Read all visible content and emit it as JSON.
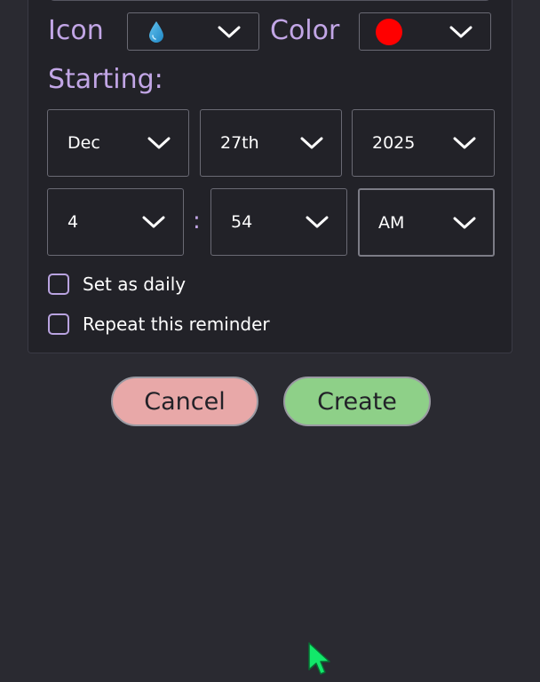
{
  "form": {
    "icon_label": "Icon",
    "color_label": "Color",
    "starting_label": "Starting:",
    "icon_select": {
      "icon": "water-drop-icon"
    },
    "color_select": {
      "color": "#ff0000"
    },
    "date": {
      "month": "Dec",
      "day": "27th",
      "year": "2025"
    },
    "time": {
      "hour": "4",
      "separator": ":",
      "minute": "54",
      "period": "AM"
    },
    "options": {
      "daily_label": "Set as daily",
      "repeat_label": "Repeat this reminder"
    }
  },
  "actions": {
    "cancel_label": "Cancel",
    "create_label": "Create"
  },
  "colors": {
    "background": "#2a2a31",
    "panel": "#222228",
    "accent_lavender": "#c2a6e6",
    "cancel": "#e8a8a8",
    "create": "#8ed088"
  }
}
